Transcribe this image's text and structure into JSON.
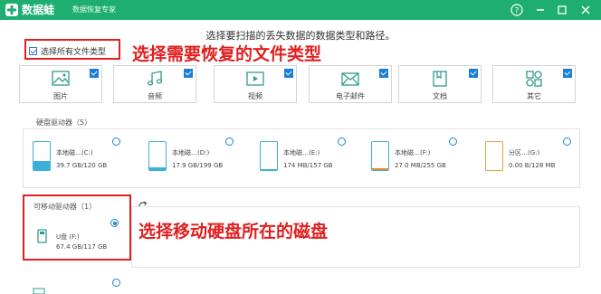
{
  "app": {
    "name": "数据蛙",
    "subtitle": "数据恢复专家"
  },
  "instruction": "选择要扫描的丢失数据的数据类型和路径。",
  "select_all": {
    "label": "选择所有文件类型",
    "checked": true
  },
  "annotations": {
    "select_types": "选择需要恢复的文件类型",
    "select_disk": "选择移动硬盘所在的磁盘"
  },
  "file_types": [
    {
      "label": "图片",
      "icon": "image-icon",
      "checked": true
    },
    {
      "label": "音频",
      "icon": "music-icon",
      "checked": true
    },
    {
      "label": "视频",
      "icon": "video-icon",
      "checked": true
    },
    {
      "label": "电子邮件",
      "icon": "email-icon",
      "checked": true
    },
    {
      "label": "文档",
      "icon": "document-icon",
      "checked": true
    },
    {
      "label": "其它",
      "icon": "other-icon",
      "checked": true
    }
  ],
  "hard_drives": {
    "title": "硬盘驱动器（5）",
    "drives": [
      {
        "name": "本地磁…(C:)",
        "size": "39.7 GB/120 GB",
        "used_fraction": 0.33,
        "color": "#3ab0d6",
        "selected": false
      },
      {
        "name": "本地磁…(D:)",
        "size": "17.9 GB/199 GB",
        "used_fraction": 0.09,
        "color": "#3ab0d6",
        "selected": false
      },
      {
        "name": "本地磁…(E:)",
        "size": "174 MB/157 GB",
        "used_fraction": 0.01,
        "color": "#3ab0d6",
        "selected": false
      },
      {
        "name": "本地磁…(F:)",
        "size": "27.0 MB/255 GB",
        "used_fraction": 0.05,
        "color": "#e8862c",
        "selected": false
      },
      {
        "name": "分区…(G:)",
        "size": "0.00 B/128 MB",
        "used_fraction": 0.0,
        "color": "#e8a23c",
        "selected": false
      }
    ]
  },
  "removable_drives": {
    "title": "可移动驱动器（1）",
    "drives": [
      {
        "name": "U盘 (F:)",
        "size": "67.4 GB/117 GB",
        "selected": true
      }
    ]
  },
  "colors": {
    "brand": "#1fae72",
    "accent": "#1a86c9",
    "annotation": "#e02020"
  }
}
